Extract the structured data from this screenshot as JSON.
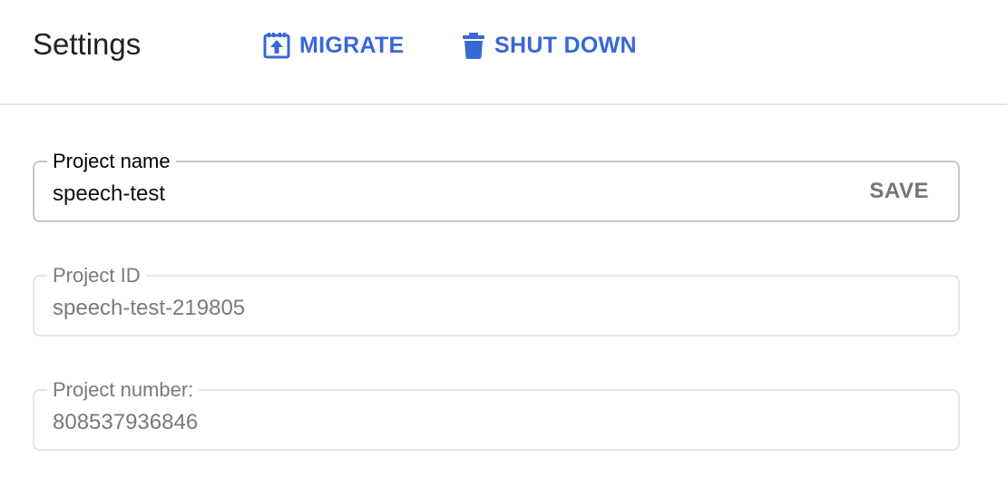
{
  "header": {
    "title": "Settings",
    "migrate_label": "MIGRATE",
    "migrate_icon": "migrate-upload-icon",
    "shutdown_label": "SHUT DOWN",
    "shutdown_icon": "trash-icon"
  },
  "fields": {
    "project_name": {
      "label": "Project name",
      "value": "speech-test",
      "save_label": "SAVE"
    },
    "project_id": {
      "label": "Project ID",
      "value": "speech-test-219805"
    },
    "project_number": {
      "label": "Project number:",
      "value": "808537936846"
    }
  },
  "colors": {
    "accent": "#3867d6",
    "disabled_text": "#7a7a7a",
    "divider": "#e3e3e3"
  }
}
